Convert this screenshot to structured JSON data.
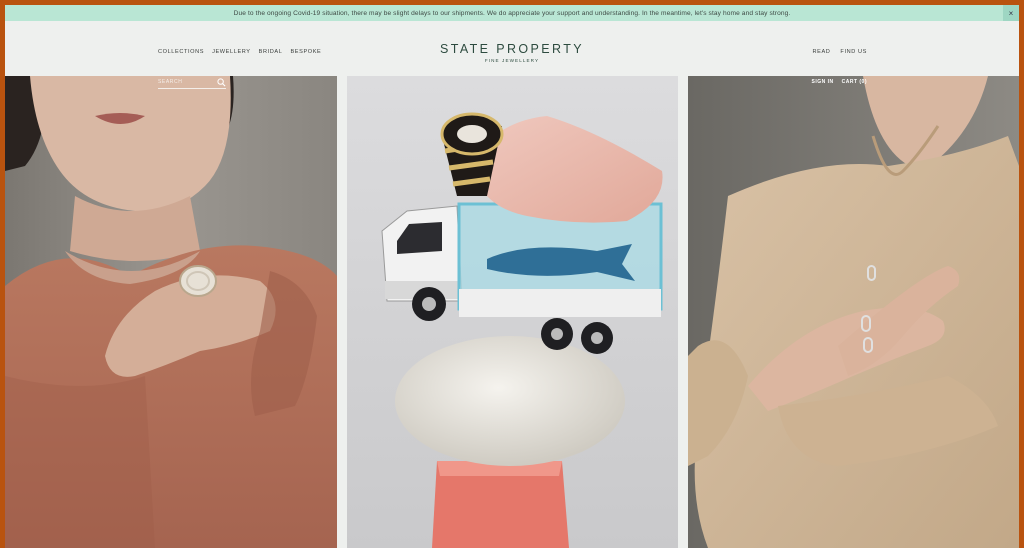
{
  "banner": {
    "text": "Due to the ongoing Covid-19 situation, there may be slight delays to our shipments. We do appreciate your support and understanding. In the meantime, let's stay home and stay strong.",
    "close_icon": "×"
  },
  "header": {
    "brand": "STATE PROPERTY",
    "tagline": "FINE JEWELLERY",
    "nav_left": [
      "COLLECTIONS",
      "JEWELLERY",
      "BRIDAL",
      "BESPOKE"
    ],
    "nav_right": [
      "READ",
      "FIND US"
    ]
  },
  "search": {
    "placeholder": "SEARCH",
    "icon": "search-icon"
  },
  "account": {
    "sign_in": "SIGN IN",
    "cart": "CART (0)"
  },
  "colors": {
    "banner_bg": "#b9e6d4",
    "brand": "#2d4b3f",
    "header_bg": "#eef0ee",
    "outer_frame": "#b9530f"
  }
}
